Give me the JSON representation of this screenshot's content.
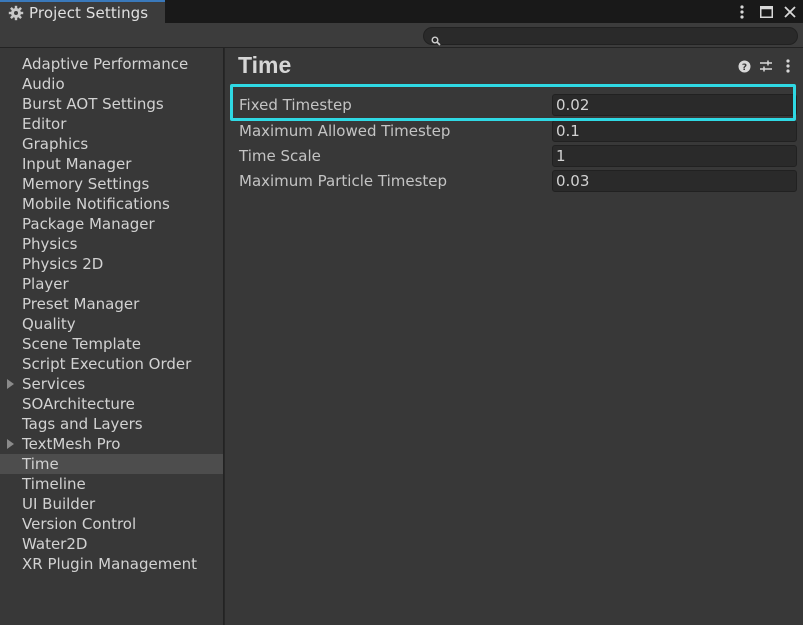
{
  "window": {
    "title": "Project Settings",
    "tab_icon": "gear-icon",
    "buttons": [
      "more-options-icon",
      "maximize-icon",
      "close-icon"
    ]
  },
  "search": {
    "placeholder": "",
    "value": ""
  },
  "sidebar": {
    "items": [
      {
        "label": "Adaptive Performance",
        "expandable": false,
        "selected": false
      },
      {
        "label": "Audio",
        "expandable": false,
        "selected": false
      },
      {
        "label": "Burst AOT Settings",
        "expandable": false,
        "selected": false
      },
      {
        "label": "Editor",
        "expandable": false,
        "selected": false
      },
      {
        "label": "Graphics",
        "expandable": false,
        "selected": false
      },
      {
        "label": "Input Manager",
        "expandable": false,
        "selected": false
      },
      {
        "label": "Memory Settings",
        "expandable": false,
        "selected": false
      },
      {
        "label": "Mobile Notifications",
        "expandable": false,
        "selected": false
      },
      {
        "label": "Package Manager",
        "expandable": false,
        "selected": false
      },
      {
        "label": "Physics",
        "expandable": false,
        "selected": false
      },
      {
        "label": "Physics 2D",
        "expandable": false,
        "selected": false
      },
      {
        "label": "Player",
        "expandable": false,
        "selected": false
      },
      {
        "label": "Preset Manager",
        "expandable": false,
        "selected": false
      },
      {
        "label": "Quality",
        "expandable": false,
        "selected": false
      },
      {
        "label": "Scene Template",
        "expandable": false,
        "selected": false
      },
      {
        "label": "Script Execution Order",
        "expandable": false,
        "selected": false
      },
      {
        "label": "Services",
        "expandable": true,
        "selected": false
      },
      {
        "label": "SOArchitecture",
        "expandable": false,
        "selected": false
      },
      {
        "label": "Tags and Layers",
        "expandable": false,
        "selected": false
      },
      {
        "label": "TextMesh Pro",
        "expandable": true,
        "selected": false
      },
      {
        "label": "Time",
        "expandable": false,
        "selected": true
      },
      {
        "label": "Timeline",
        "expandable": false,
        "selected": false
      },
      {
        "label": "UI Builder",
        "expandable": false,
        "selected": false
      },
      {
        "label": "Version Control",
        "expandable": false,
        "selected": false
      },
      {
        "label": "Water2D",
        "expandable": false,
        "selected": false
      },
      {
        "label": "XR Plugin Management",
        "expandable": false,
        "selected": false
      }
    ]
  },
  "main": {
    "title": "Time",
    "header_icons": [
      "help-icon",
      "presets-icon",
      "more-options-icon"
    ],
    "fields": [
      {
        "label": "Fixed Timestep",
        "value": "0.02"
      },
      {
        "label": "Maximum Allowed Timestep",
        "value": "0.1"
      },
      {
        "label": "Time Scale",
        "value": "1"
      },
      {
        "label": "Maximum Particle Timestep",
        "value": "0.03"
      }
    ]
  },
  "colors": {
    "highlight": "#2fd9e4",
    "tab_accent": "#3a79bb",
    "panel_bg": "#383838"
  }
}
